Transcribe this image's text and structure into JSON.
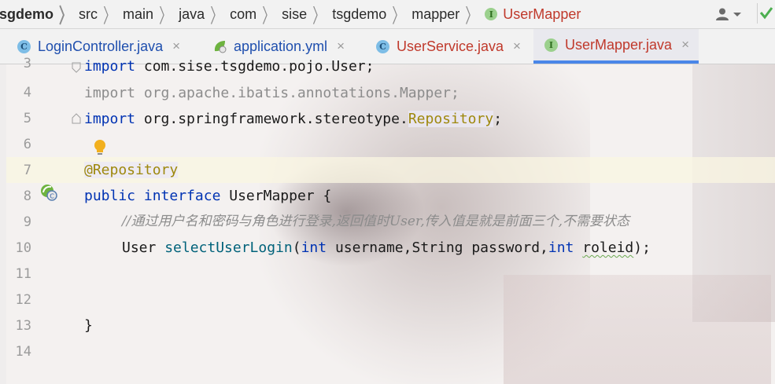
{
  "breadcrumb": {
    "items": [
      "tsgdemo",
      "src",
      "main",
      "java",
      "com",
      "sise",
      "tsgdemo",
      "mapper"
    ],
    "current": "UserMapper",
    "current_icon": "I"
  },
  "tabs": [
    {
      "label": "LoginController.java",
      "icon": "C",
      "color": "blue",
      "active": false
    },
    {
      "label": "application.yml",
      "icon": "spring-leaf-icon",
      "color": "blue",
      "active": false
    },
    {
      "label": "UserService.java",
      "icon": "C",
      "color": "red",
      "active": false
    },
    {
      "label": "UserMapper.java",
      "icon": "I",
      "color": "red",
      "active": true
    }
  ],
  "close_glyph": "×",
  "editor": {
    "line_numbers": [
      "3",
      "4",
      "5",
      "6",
      "7",
      "8",
      "9",
      "10",
      "11",
      "12",
      "13",
      "14"
    ],
    "line3_kw": "import",
    "line3_rest": " com.sise.tsgdemo.pojo.User;",
    "line4": "import org.apache.ibatis.annotations.Mapper;",
    "line5_kw": "import",
    "line5_pkg": " org.springframework.stereotype.",
    "line5_cls": "Repository",
    "line5_end": ";",
    "line7": "@Repository",
    "line8_kw1": "public",
    "line8_kw2": "interface",
    "line8_rest": " UserMapper {",
    "line9": "//通过用户名和密码与角色进行登录,返回值时User,传入值是就是前面三个,不需要状态",
    "line10_type": "User ",
    "line10_fn": "selectUserLogin",
    "line10_p1": "(",
    "line10_int1": "int",
    "line10_mid": " username,String password,",
    "line10_int2": "int",
    "line10_sp": " ",
    "line10_role": "roleid",
    "line10_end": ");",
    "line13": "}"
  },
  "colors": {
    "keyword": "#0033b3",
    "annotation": "#9e880d",
    "method": "#00627a",
    "comment": "#8c8c8c",
    "active_tab_underline": "#4a86e8"
  }
}
